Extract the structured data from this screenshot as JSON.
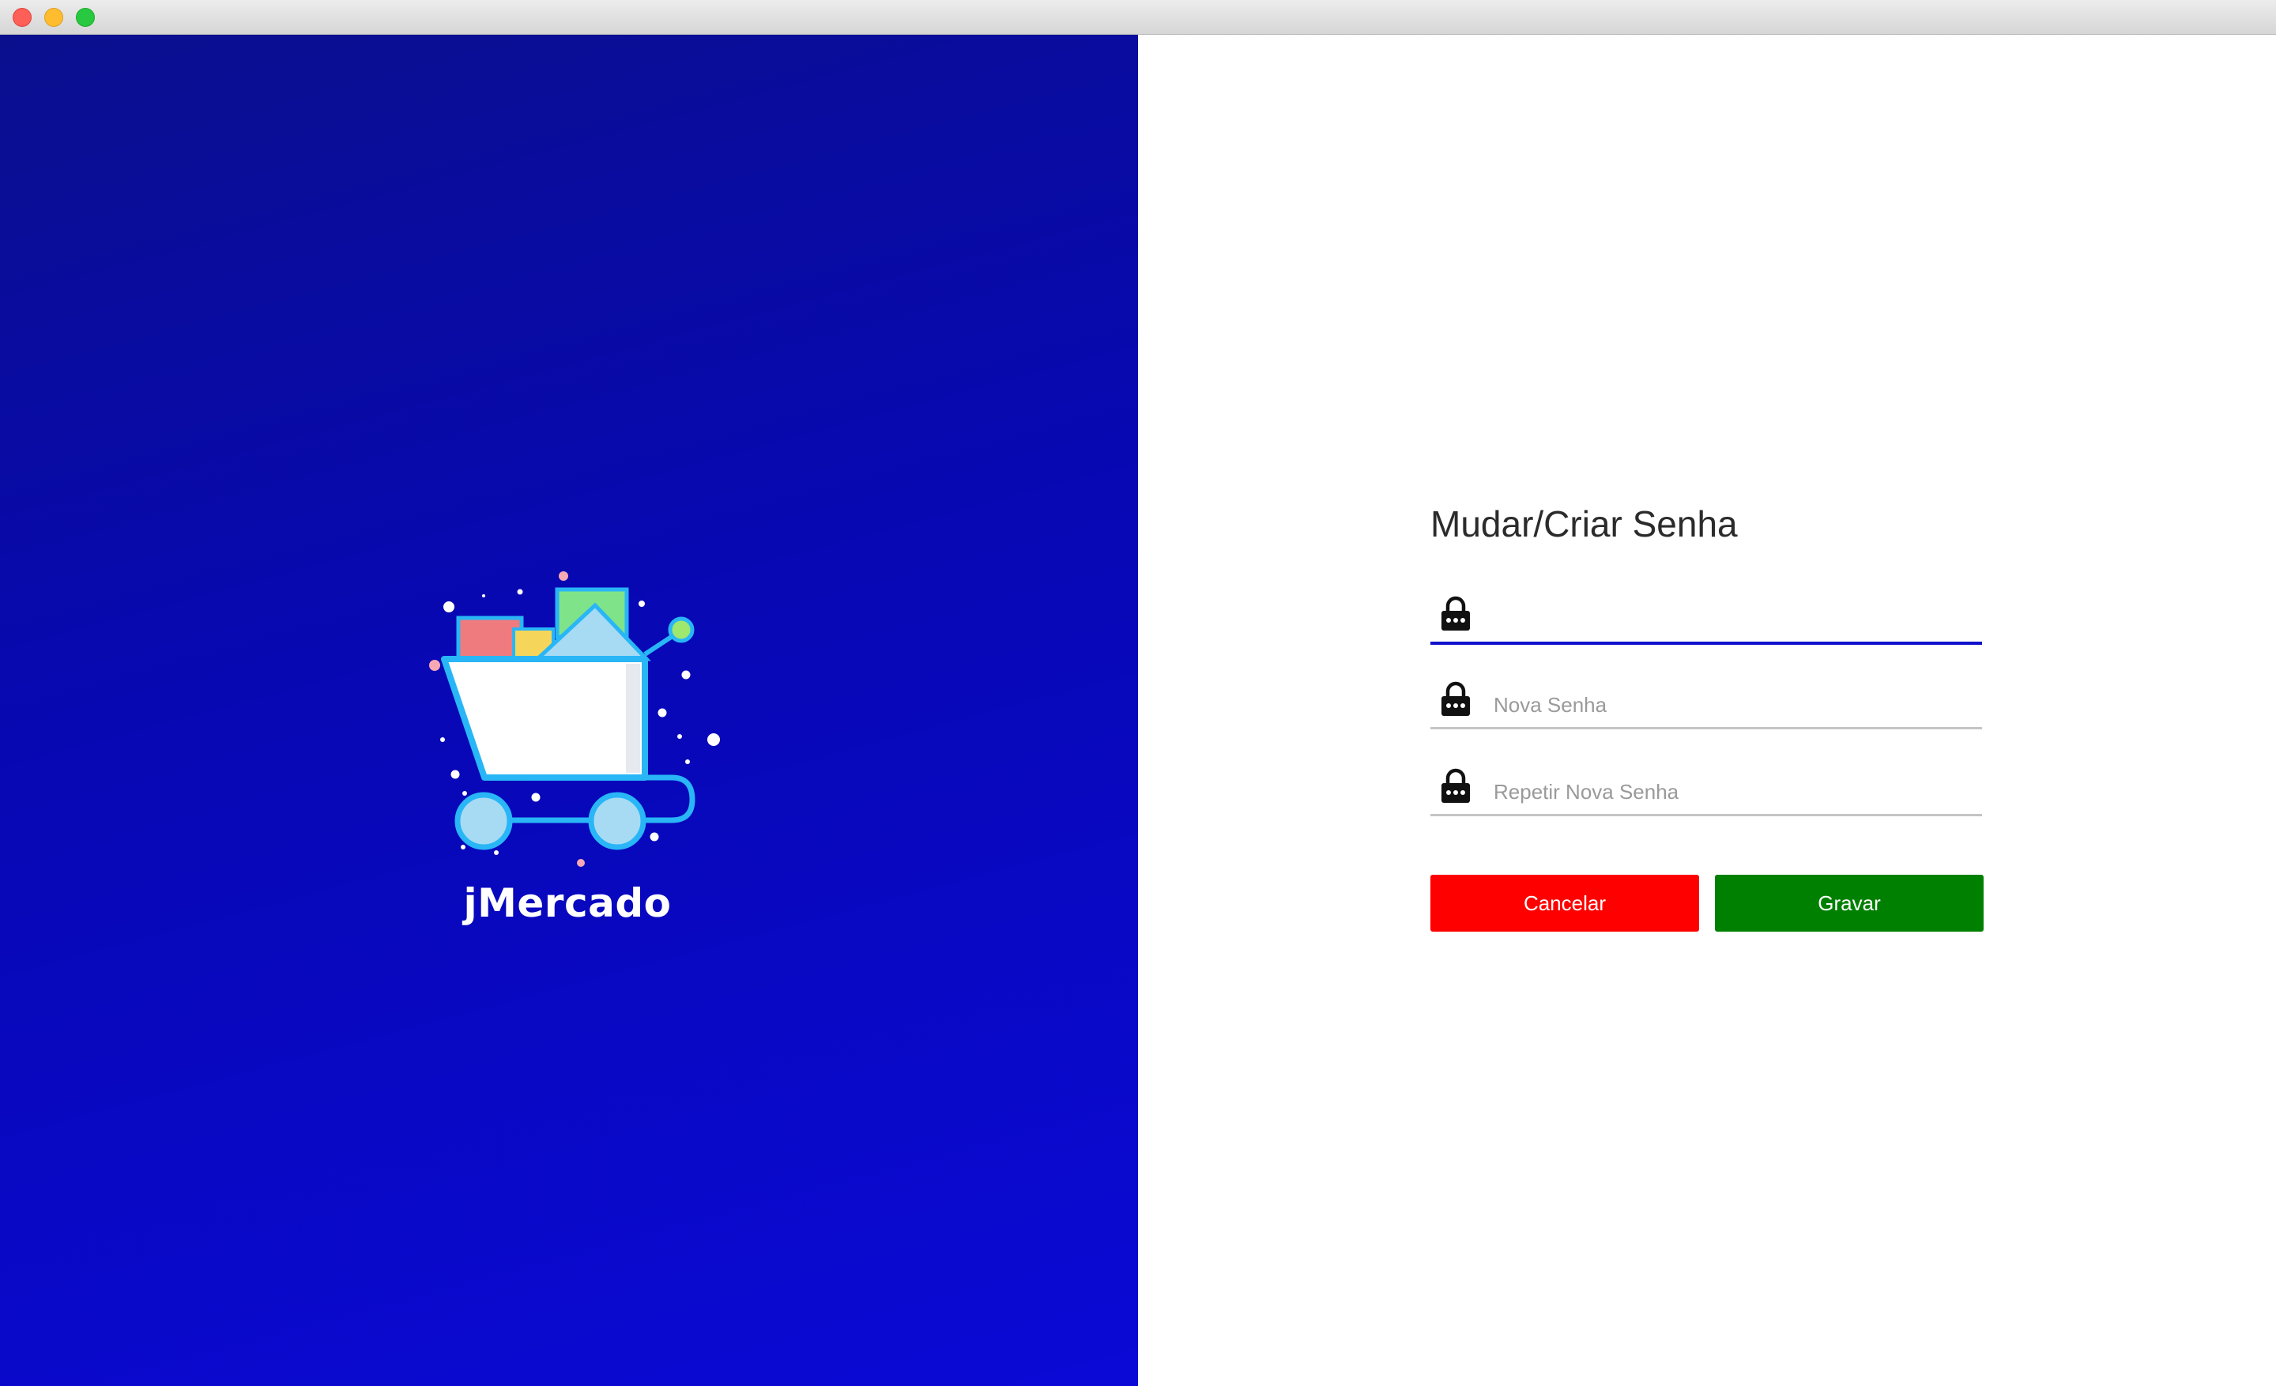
{
  "window": {
    "controls": [
      "close",
      "minimize",
      "maximize"
    ]
  },
  "brand": {
    "name": "jMercado",
    "logo_icon": "shopping-cart-icon"
  },
  "form": {
    "title": "Mudar/Criar Senha",
    "fields": [
      {
        "icon": "lock-icon",
        "value": "",
        "placeholder": ""
      },
      {
        "icon": "lock-icon",
        "value": "",
        "placeholder": "Nova Senha"
      },
      {
        "icon": "lock-icon",
        "value": "",
        "placeholder": "Repetir Nova Senha"
      }
    ],
    "cancel_label": "Cancelar",
    "save_label": "Gravar"
  },
  "colors": {
    "left_gradient_top": "#0a0f8e",
    "left_gradient_bottom": "#0a09d6",
    "focus_underline": "#1111cc",
    "cancel_button": "#ff0000",
    "save_button": "#008000"
  }
}
